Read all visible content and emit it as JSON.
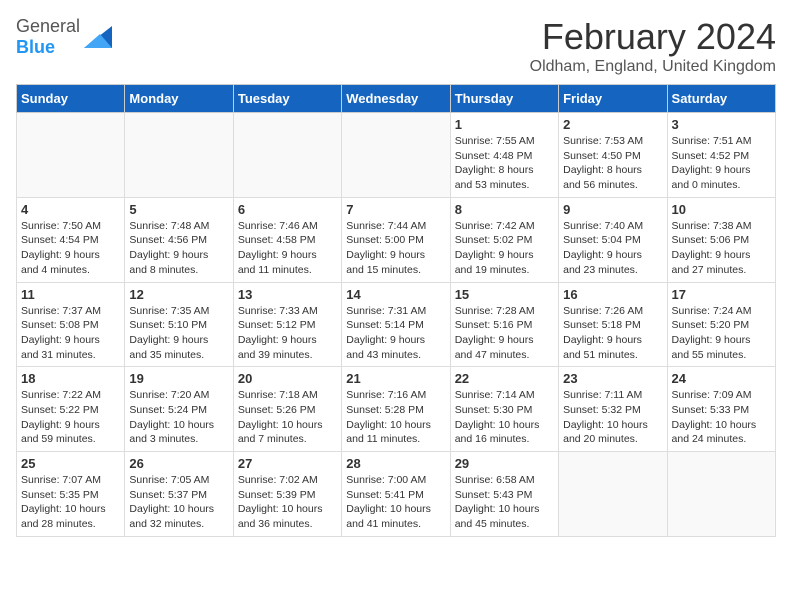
{
  "header": {
    "logo_general": "General",
    "logo_blue": "Blue",
    "title": "February 2024",
    "location": "Oldham, England, United Kingdom"
  },
  "days_of_week": [
    "Sunday",
    "Monday",
    "Tuesday",
    "Wednesday",
    "Thursday",
    "Friday",
    "Saturday"
  ],
  "weeks": [
    [
      {
        "day": "",
        "info": "",
        "empty": true
      },
      {
        "day": "",
        "info": "",
        "empty": true
      },
      {
        "day": "",
        "info": "",
        "empty": true
      },
      {
        "day": "",
        "info": "",
        "empty": true
      },
      {
        "day": "1",
        "info": "Sunrise: 7:55 AM\nSunset: 4:48 PM\nDaylight: 8 hours\nand 53 minutes.",
        "empty": false
      },
      {
        "day": "2",
        "info": "Sunrise: 7:53 AM\nSunset: 4:50 PM\nDaylight: 8 hours\nand 56 minutes.",
        "empty": false
      },
      {
        "day": "3",
        "info": "Sunrise: 7:51 AM\nSunset: 4:52 PM\nDaylight: 9 hours\nand 0 minutes.",
        "empty": false
      }
    ],
    [
      {
        "day": "4",
        "info": "Sunrise: 7:50 AM\nSunset: 4:54 PM\nDaylight: 9 hours\nand 4 minutes.",
        "empty": false
      },
      {
        "day": "5",
        "info": "Sunrise: 7:48 AM\nSunset: 4:56 PM\nDaylight: 9 hours\nand 8 minutes.",
        "empty": false
      },
      {
        "day": "6",
        "info": "Sunrise: 7:46 AM\nSunset: 4:58 PM\nDaylight: 9 hours\nand 11 minutes.",
        "empty": false
      },
      {
        "day": "7",
        "info": "Sunrise: 7:44 AM\nSunset: 5:00 PM\nDaylight: 9 hours\nand 15 minutes.",
        "empty": false
      },
      {
        "day": "8",
        "info": "Sunrise: 7:42 AM\nSunset: 5:02 PM\nDaylight: 9 hours\nand 19 minutes.",
        "empty": false
      },
      {
        "day": "9",
        "info": "Sunrise: 7:40 AM\nSunset: 5:04 PM\nDaylight: 9 hours\nand 23 minutes.",
        "empty": false
      },
      {
        "day": "10",
        "info": "Sunrise: 7:38 AM\nSunset: 5:06 PM\nDaylight: 9 hours\nand 27 minutes.",
        "empty": false
      }
    ],
    [
      {
        "day": "11",
        "info": "Sunrise: 7:37 AM\nSunset: 5:08 PM\nDaylight: 9 hours\nand 31 minutes.",
        "empty": false
      },
      {
        "day": "12",
        "info": "Sunrise: 7:35 AM\nSunset: 5:10 PM\nDaylight: 9 hours\nand 35 minutes.",
        "empty": false
      },
      {
        "day": "13",
        "info": "Sunrise: 7:33 AM\nSunset: 5:12 PM\nDaylight: 9 hours\nand 39 minutes.",
        "empty": false
      },
      {
        "day": "14",
        "info": "Sunrise: 7:31 AM\nSunset: 5:14 PM\nDaylight: 9 hours\nand 43 minutes.",
        "empty": false
      },
      {
        "day": "15",
        "info": "Sunrise: 7:28 AM\nSunset: 5:16 PM\nDaylight: 9 hours\nand 47 minutes.",
        "empty": false
      },
      {
        "day": "16",
        "info": "Sunrise: 7:26 AM\nSunset: 5:18 PM\nDaylight: 9 hours\nand 51 minutes.",
        "empty": false
      },
      {
        "day": "17",
        "info": "Sunrise: 7:24 AM\nSunset: 5:20 PM\nDaylight: 9 hours\nand 55 minutes.",
        "empty": false
      }
    ],
    [
      {
        "day": "18",
        "info": "Sunrise: 7:22 AM\nSunset: 5:22 PM\nDaylight: 9 hours\nand 59 minutes.",
        "empty": false
      },
      {
        "day": "19",
        "info": "Sunrise: 7:20 AM\nSunset: 5:24 PM\nDaylight: 10 hours\nand 3 minutes.",
        "empty": false
      },
      {
        "day": "20",
        "info": "Sunrise: 7:18 AM\nSunset: 5:26 PM\nDaylight: 10 hours\nand 7 minutes.",
        "empty": false
      },
      {
        "day": "21",
        "info": "Sunrise: 7:16 AM\nSunset: 5:28 PM\nDaylight: 10 hours\nand 11 minutes.",
        "empty": false
      },
      {
        "day": "22",
        "info": "Sunrise: 7:14 AM\nSunset: 5:30 PM\nDaylight: 10 hours\nand 16 minutes.",
        "empty": false
      },
      {
        "day": "23",
        "info": "Sunrise: 7:11 AM\nSunset: 5:32 PM\nDaylight: 10 hours\nand 20 minutes.",
        "empty": false
      },
      {
        "day": "24",
        "info": "Sunrise: 7:09 AM\nSunset: 5:33 PM\nDaylight: 10 hours\nand 24 minutes.",
        "empty": false
      }
    ],
    [
      {
        "day": "25",
        "info": "Sunrise: 7:07 AM\nSunset: 5:35 PM\nDaylight: 10 hours\nand 28 minutes.",
        "empty": false
      },
      {
        "day": "26",
        "info": "Sunrise: 7:05 AM\nSunset: 5:37 PM\nDaylight: 10 hours\nand 32 minutes.",
        "empty": false
      },
      {
        "day": "27",
        "info": "Sunrise: 7:02 AM\nSunset: 5:39 PM\nDaylight: 10 hours\nand 36 minutes.",
        "empty": false
      },
      {
        "day": "28",
        "info": "Sunrise: 7:00 AM\nSunset: 5:41 PM\nDaylight: 10 hours\nand 41 minutes.",
        "empty": false
      },
      {
        "day": "29",
        "info": "Sunrise: 6:58 AM\nSunset: 5:43 PM\nDaylight: 10 hours\nand 45 minutes.",
        "empty": false
      },
      {
        "day": "",
        "info": "",
        "empty": true
      },
      {
        "day": "",
        "info": "",
        "empty": true
      }
    ]
  ]
}
